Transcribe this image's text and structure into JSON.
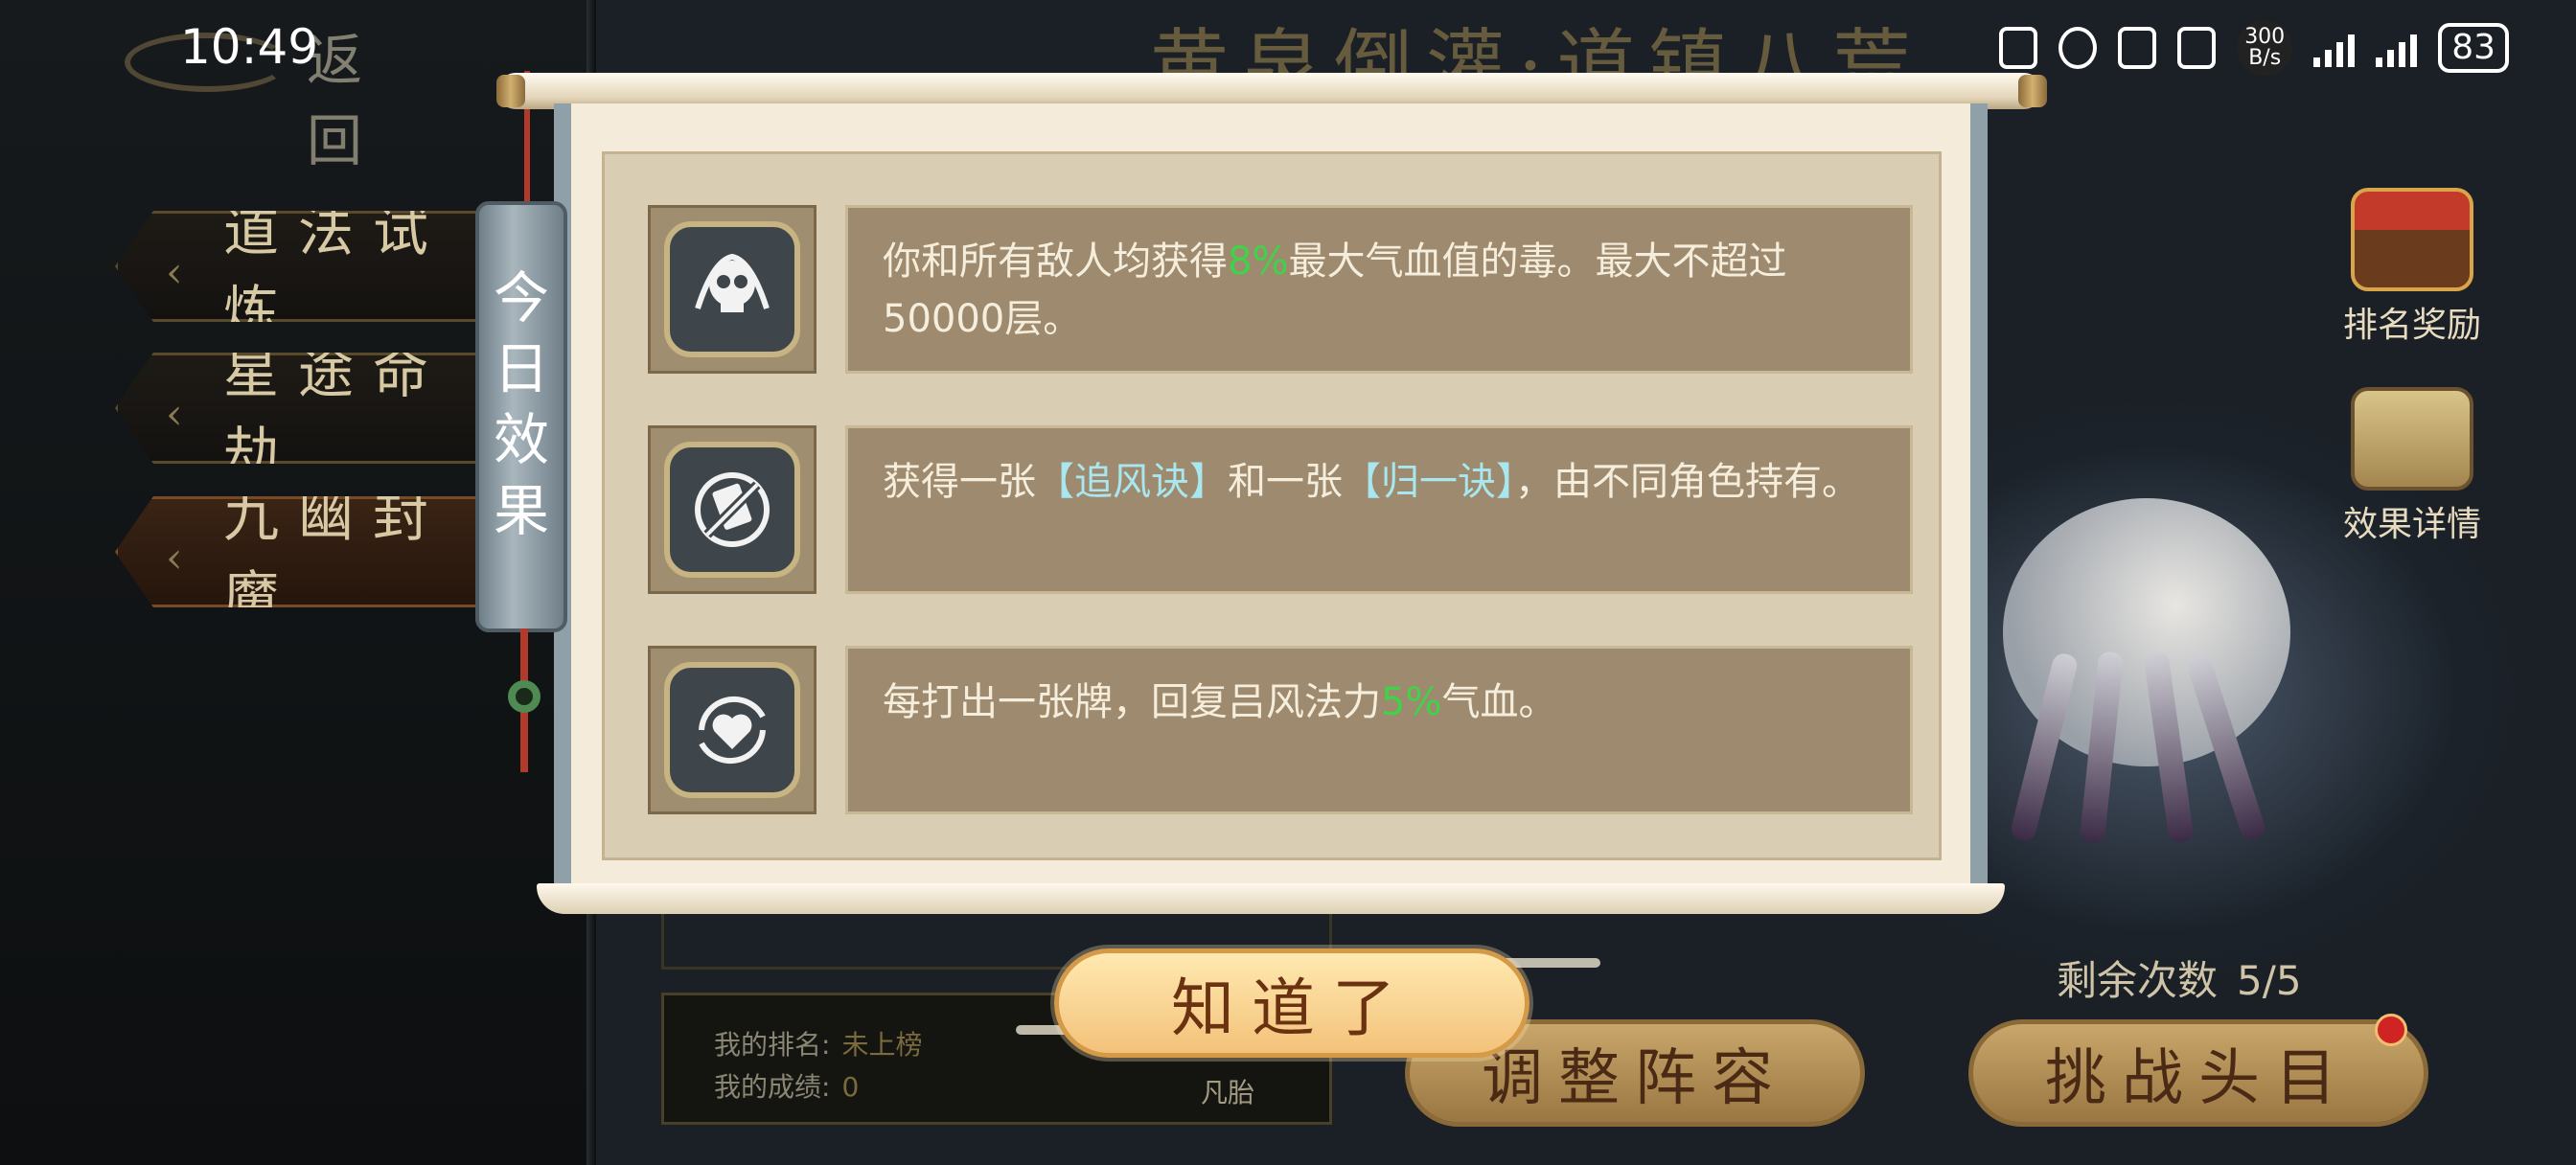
{
  "status_bar": {
    "time": "10:49",
    "net_speed_value": "300",
    "net_speed_unit": "B/s",
    "battery": "83"
  },
  "header": {
    "back_label": "返回",
    "game_title": "黄泉倒灌·道镇八荒"
  },
  "left_menu": {
    "items": [
      {
        "label": "道法试炼"
      },
      {
        "label": "星途命劫"
      },
      {
        "label": "九幽封魔"
      }
    ]
  },
  "right_panel": {
    "rank_reward_label": "排名奖励",
    "effect_detail_label": "效果详情",
    "remaining_label": "剩余次数",
    "remaining_value": "5/5"
  },
  "rank_box": {
    "my_rank_label": "我的排名:",
    "my_rank_value": "未上榜",
    "my_score_label": "我的成绩:",
    "my_score_value": "0",
    "chip_label": "凡胎"
  },
  "buttons": {
    "adjust_lineup": "调整阵容",
    "challenge_boss": "挑战头目",
    "confirm": "知道了"
  },
  "popup": {
    "tag_text": "今日效果",
    "effects": [
      {
        "icon": "skull-icon",
        "text_before": "你和所有敌人均获得",
        "highlight": "8%",
        "text_after": "最大气血值的毒。最大不超过50000层。"
      },
      {
        "icon": "no-card-icon",
        "text_before": "获得一张",
        "card1": "【追风诀】",
        "text_middle": "和一张",
        "card2": "【归一诀】",
        "text_after": "，由不同角色持有。"
      },
      {
        "icon": "heart-icon",
        "text_before": "每打出一张牌，回复吕风法力",
        "highlight": "5%",
        "text_after": "气血。"
      }
    ]
  },
  "colors": {
    "highlight_green": "#3fd24a",
    "card_blue": "#a9e7f0",
    "scroll_paper": "#f4ebda",
    "effect_box": "#9e8b6f"
  }
}
